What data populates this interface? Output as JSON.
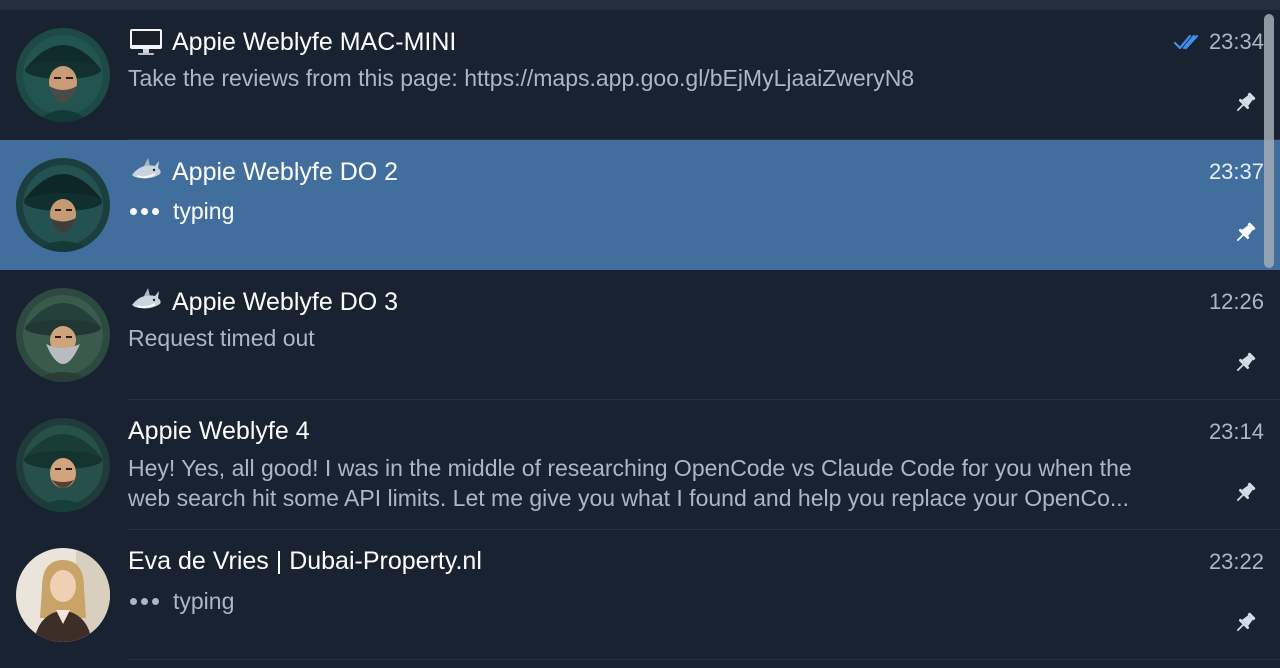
{
  "colors": {
    "background": "#182230",
    "selected_row": "#426e9e",
    "accent_check": "#3f8ff0",
    "secondary_text": "#a9b8c9"
  },
  "chats": [
    {
      "title_icon": "desktop-computer-icon",
      "title": "Appie Weblyfe MAC-MINI",
      "time": "23:34",
      "status_icon": "double-check-icon",
      "preview_lines": [
        "Take the reviews from this page: https://maps.app.goo.gl/bEjMyLjaaiZweryN8"
      ],
      "pinned": true,
      "selected": false
    },
    {
      "title_icon": "shark-icon",
      "title": "Appie Weblyfe DO 2",
      "time": "23:37",
      "typing": "typing",
      "pinned": true,
      "selected": true
    },
    {
      "title_icon": "shark-icon",
      "title": "Appie Weblyfe DO 3",
      "time": "12:26",
      "preview_lines": [
        "Request timed out"
      ],
      "pinned": true,
      "selected": false
    },
    {
      "title": "Appie Weblyfe 4",
      "time": "23:14",
      "preview_lines": [
        "Hey! Yes, all good! I was in the middle of researching OpenCode vs Claude Code for you when the",
        "web search hit some API limits.  Let me give you what I found and help you replace your OpenCo..."
      ],
      "pinned": true,
      "selected": false
    },
    {
      "title": "Eva de Vries | Dubai-Property.nl",
      "time": "23:22",
      "typing": "typing",
      "pinned": true,
      "selected": false
    }
  ]
}
